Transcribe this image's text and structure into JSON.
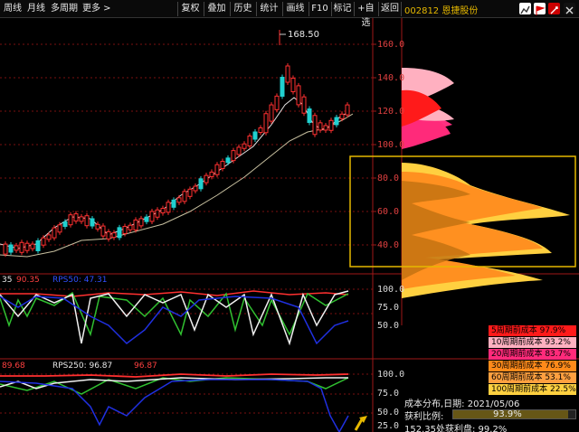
{
  "toolbar": {
    "left": [
      "周线",
      "月线",
      "多周期",
      "更多 >"
    ],
    "right": [
      "复权",
      "叠加",
      "历史",
      "统计",
      "画线",
      "F10",
      "标记",
      "+自选",
      "返回"
    ]
  },
  "stock_title": "002812 恩捷股份",
  "main_axis": [
    "160.0",
    "140.0",
    "120.0",
    "100.0",
    "80.0",
    "60.0",
    "40.0"
  ],
  "peak_label": "168.50",
  "colors": {
    "up": "#ff3030",
    "down": "#20d0d0",
    "accent": "#e6b800",
    "ma1": "#e0e0e0",
    "ma2": "#c8c0a0"
  },
  "panel1": {
    "header": {
      "v1": "35",
      "v2": "90.35",
      "v3": "RPS50: 47.31"
    },
    "axis": [
      "100.0",
      "75.0",
      "50.0"
    ]
  },
  "panel2": {
    "header": {
      "v1": "89.68",
      "v2": "RPS250: 96.87",
      "v3": "96.87"
    },
    "axis": [
      "100.0",
      "75.0",
      "50.0",
      "25.0"
    ]
  },
  "legend": [
    {
      "label": "5周期前成本 97.9%",
      "color": "#ff1a1a"
    },
    {
      "label": "10周期前成本 93.2%",
      "color": "#ffb0c0"
    },
    {
      "label": "20周期前成本 83.7%",
      "color": "#ff2a7a"
    },
    {
      "label": "30周期前成本 76.9%",
      "color": "#ff8a1a"
    },
    {
      "label": "60周期前成本 53.1%",
      "color": "#ffa040"
    },
    {
      "label": "100周期前成本 22.5%",
      "color": "#ffd040"
    }
  ],
  "info": {
    "line1": "成本分布,日期:   2021/05/06",
    "profit_label": "获利比例:",
    "profit_value": "93.9%",
    "line3": "152.35处获利盘:   99.2%"
  }
}
